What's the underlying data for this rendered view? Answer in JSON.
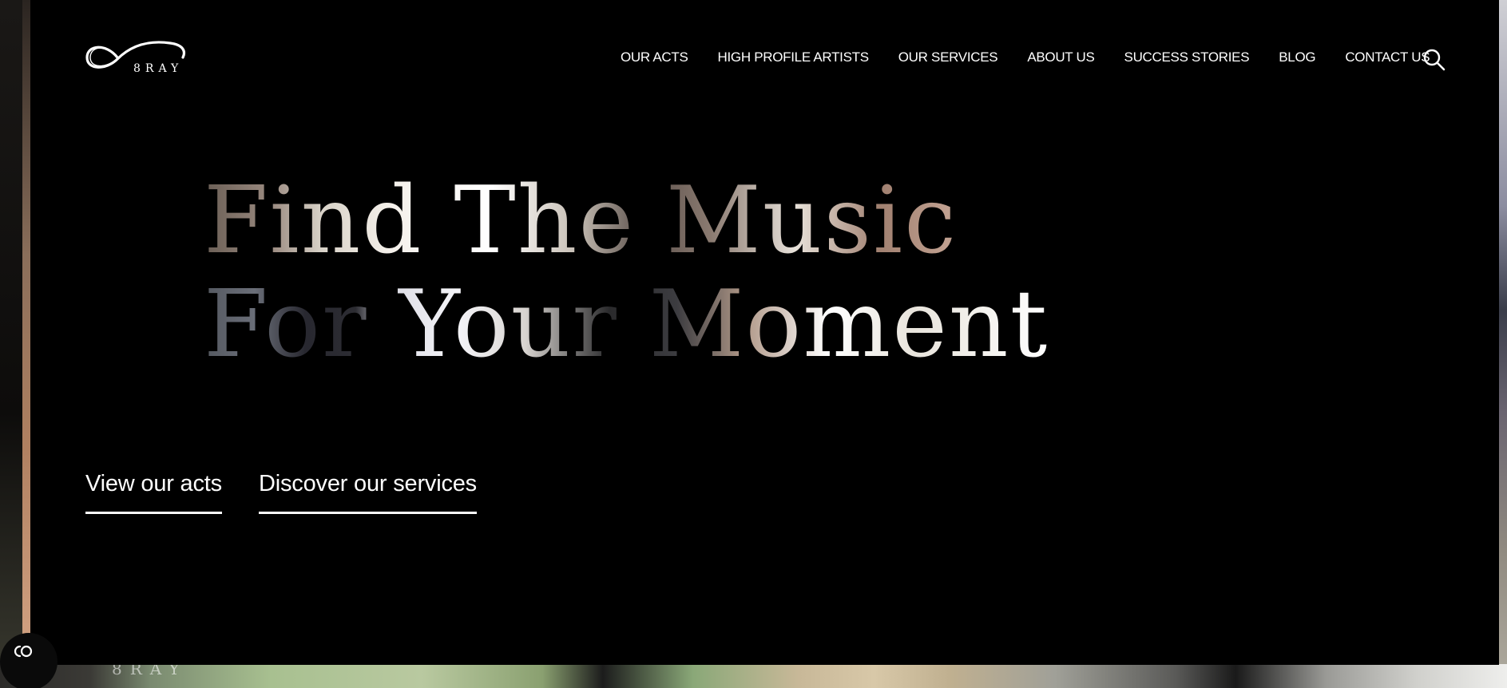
{
  "brand": {
    "logo_text": "8RAY"
  },
  "nav": {
    "items": [
      {
        "label": "OUR ACTS"
      },
      {
        "label": "HIGH PROFILE ARTISTS"
      },
      {
        "label": "OUR SERVICES"
      },
      {
        "label": "ABOUT US"
      },
      {
        "label": "SUCCESS STORIES"
      },
      {
        "label": "BLOG"
      },
      {
        "label": "CONTACT US"
      }
    ],
    "search_icon": "search-icon"
  },
  "hero": {
    "line1": "Find The Music",
    "line2": "For Your Moment"
  },
  "cta": {
    "acts_label": "View our acts",
    "services_label": "Discover our services"
  },
  "video_overlay": {
    "logo_text": "8RAY"
  },
  "colors": {
    "background": "#000000",
    "text": "#ffffff"
  }
}
